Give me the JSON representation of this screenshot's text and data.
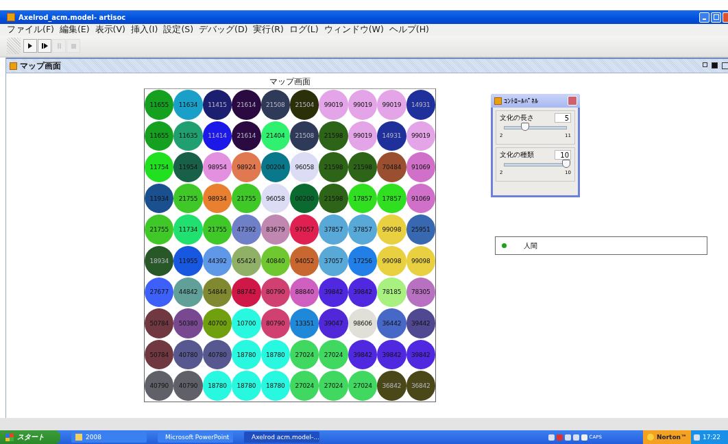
{
  "window": {
    "title": "Axelrod_acm.model- artisoc"
  },
  "menu": [
    "ファイル(F)",
    "編集(E)",
    "表示(V)",
    "挿入(I)",
    "設定(S)",
    "デバッグ(D)",
    "実行(R)",
    "ログ(L)",
    "ウィンドウ(W)",
    "ヘルプ(H)"
  ],
  "toolbar": [
    {
      "kind": "play",
      "disabled": false
    },
    {
      "kind": "step",
      "disabled": false
    },
    {
      "kind": "pause",
      "disabled": true
    },
    {
      "kind": "stop",
      "disabled": true
    }
  ],
  "frame": {
    "title": "マップ画面"
  },
  "map": {
    "title": "マップ画面",
    "cells": [
      [
        {
          "label": "11655",
          "color": "#16a020"
        },
        {
          "label": "11634",
          "color": "#1aa0c8"
        },
        {
          "label": "11415",
          "color": "#1c1e70"
        },
        {
          "label": "21614",
          "color": "#2a0a40"
        },
        {
          "label": "21508",
          "color": "#2e3a58"
        },
        {
          "label": "21504",
          "color": "#2c3008"
        },
        {
          "label": "99019",
          "color": "#e4a4e8"
        },
        {
          "label": "99019",
          "color": "#e4a4e8"
        },
        {
          "label": "99019",
          "color": "#e4a4e8"
        },
        {
          "label": "14931",
          "color": "#20309a"
        }
      ],
      [
        {
          "label": "11655",
          "color": "#16a020"
        },
        {
          "label": "11635",
          "color": "#20a070"
        },
        {
          "label": "11414",
          "color": "#1c18e8"
        },
        {
          "label": "21614",
          "color": "#2a0a40"
        },
        {
          "label": "21404",
          "color": "#30f070"
        },
        {
          "label": "21508",
          "color": "#2e3a58"
        },
        {
          "label": "21598",
          "color": "#2e6418"
        },
        {
          "label": "99019",
          "color": "#e4a4e8"
        },
        {
          "label": "14931",
          "color": "#20309a"
        },
        {
          "label": "99019",
          "color": "#e4a4e8"
        }
      ],
      [
        {
          "label": "11754",
          "color": "#20e020"
        },
        {
          "label": "11954",
          "color": "#186048"
        },
        {
          "label": "98954",
          "color": "#e490e0"
        },
        {
          "label": "98924",
          "color": "#e07850"
        },
        {
          "label": "00204",
          "color": "#08788a"
        },
        {
          "label": "96058",
          "color": "#dcdcf4"
        },
        {
          "label": "21598",
          "color": "#2e6418"
        },
        {
          "label": "21598",
          "color": "#2e6418"
        },
        {
          "label": "70484",
          "color": "#9a5030"
        },
        {
          "label": "91069",
          "color": "#d070c8"
        }
      ],
      [
        {
          "label": "11934",
          "color": "#1a5090"
        },
        {
          "label": "21755",
          "color": "#40c828"
        },
        {
          "label": "98934",
          "color": "#e88030"
        },
        {
          "label": "21755",
          "color": "#40c828"
        },
        {
          "label": "96058",
          "color": "#dcdcf4"
        },
        {
          "label": "00200",
          "color": "#0a6a30"
        },
        {
          "label": "21598",
          "color": "#2e6418"
        },
        {
          "label": "17857",
          "color": "#30e020"
        },
        {
          "label": "17857",
          "color": "#30e020"
        },
        {
          "label": "91069",
          "color": "#d070c8"
        }
      ],
      [
        {
          "label": "21755",
          "color": "#40c828"
        },
        {
          "label": "11734",
          "color": "#20e070"
        },
        {
          "label": "21755",
          "color": "#40c828"
        },
        {
          "label": "47392",
          "color": "#7080c8"
        },
        {
          "label": "83679",
          "color": "#c088b0"
        },
        {
          "label": "97057",
          "color": "#e02050"
        },
        {
          "label": "37857",
          "color": "#58a8d8"
        },
        {
          "label": "37857",
          "color": "#58a8d8"
        },
        {
          "label": "99098",
          "color": "#e8d040"
        },
        {
          "label": "25951",
          "color": "#3868b0"
        }
      ],
      [
        {
          "label": "18934",
          "color": "#285828"
        },
        {
          "label": "11955",
          "color": "#1858e0"
        },
        {
          "label": "44392",
          "color": "#6098e8"
        },
        {
          "label": "65424",
          "color": "#90b068"
        },
        {
          "label": "40840",
          "color": "#70c830"
        },
        {
          "label": "94052",
          "color": "#c86830"
        },
        {
          "label": "37057",
          "color": "#58a8d8"
        },
        {
          "label": "17256",
          "color": "#2080e8"
        },
        {
          "label": "99098",
          "color": "#e8d040"
        },
        {
          "label": "99098",
          "color": "#e8d040"
        }
      ],
      [
        {
          "label": "27677",
          "color": "#3c60f8"
        },
        {
          "label": "44842",
          "color": "#60a098"
        },
        {
          "label": "54844",
          "color": "#808830"
        },
        {
          "label": "88742",
          "color": "#d01848"
        },
        {
          "label": "80790",
          "color": "#d04070"
        },
        {
          "label": "88840",
          "color": "#d060c0"
        },
        {
          "label": "39842",
          "color": "#5028e0"
        },
        {
          "label": "39842",
          "color": "#5028e0"
        },
        {
          "label": "78185",
          "color": "#a8f080"
        },
        {
          "label": "78305",
          "color": "#b870c0"
        }
      ],
      [
        {
          "label": "50784",
          "color": "#703840"
        },
        {
          "label": "50380",
          "color": "#784890"
        },
        {
          "label": "40700",
          "color": "#70a010"
        },
        {
          "label": "10700",
          "color": "#28f8e0"
        },
        {
          "label": "80790",
          "color": "#d04070"
        },
        {
          "label": "13351",
          "color": "#2088d8"
        },
        {
          "label": "39047",
          "color": "#5028d8"
        },
        {
          "label": "98606",
          "color": "#e0e0d8"
        },
        {
          "label": "36442",
          "color": "#4868c8"
        },
        {
          "label": "39442",
          "color": "#504890"
        }
      ],
      [
        {
          "label": "50784",
          "color": "#703840"
        },
        {
          "label": "40780",
          "color": "#585890"
        },
        {
          "label": "40780",
          "color": "#585890"
        },
        {
          "label": "18780",
          "color": "#28f8e0"
        },
        {
          "label": "18780",
          "color": "#28f8e0"
        },
        {
          "label": "27024",
          "color": "#40d860"
        },
        {
          "label": "27024",
          "color": "#40d860"
        },
        {
          "label": "39842",
          "color": "#5028e0"
        },
        {
          "label": "39842",
          "color": "#5028e0"
        },
        {
          "label": "39842",
          "color": "#5028e0"
        }
      ],
      [
        {
          "label": "40790",
          "color": "#606068"
        },
        {
          "label": "40790",
          "color": "#606068"
        },
        {
          "label": "18780",
          "color": "#28f8e0"
        },
        {
          "label": "18780",
          "color": "#28f8e0"
        },
        {
          "label": "18780",
          "color": "#28f8e0"
        },
        {
          "label": "27024",
          "color": "#40d860"
        },
        {
          "label": "27024",
          "color": "#40d860"
        },
        {
          "label": "27024",
          "color": "#40d860"
        },
        {
          "label": "36842",
          "color": "#4a4818"
        },
        {
          "label": "36842",
          "color": "#4a4818"
        }
      ]
    ]
  },
  "control_panel": {
    "title": "ｺﾝﾄﾛｰﾙﾊﾟﾈﾙ",
    "sliders": [
      {
        "label": "文化の長さ",
        "value": "5",
        "min": "2",
        "max": "11",
        "level": 0.333
      },
      {
        "label": "文化の種類",
        "value": "10",
        "min": "2",
        "max": "10",
        "level": 1
      }
    ]
  },
  "legend": [
    {
      "label": "人間",
      "color": "#20a020"
    }
  ],
  "taskbar": {
    "start": "スタート",
    "tasks": [
      {
        "label": "2008",
        "kind": "folder",
        "selected": false
      },
      {
        "label": "Microsoft PowerPoint",
        "kind": "app",
        "selected": false
      },
      {
        "label": "Axelrod acm.model-...",
        "kind": "artisoc",
        "selected": true
      }
    ],
    "tray_text": "CAPS",
    "norton": "Norton™",
    "clock": "17:22"
  }
}
